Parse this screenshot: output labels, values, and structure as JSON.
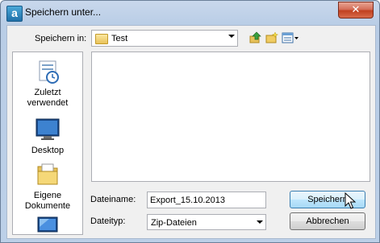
{
  "window": {
    "title": "Speichern unter...",
    "app_icon_letter": "a",
    "close_glyph": "✕"
  },
  "toolbar": {
    "save_in_label": "Speichern in:",
    "folder_value": "Test",
    "icons": [
      "folder-up-icon",
      "new-folder-icon",
      "view-menu-icon"
    ]
  },
  "places": [
    {
      "name": "recent",
      "label_line1": "Zuletzt",
      "label_line2": "verwendet",
      "icon": "recent-icon"
    },
    {
      "name": "desktop",
      "label_line1": "Desktop",
      "label_line2": "",
      "icon": "desktop-icon"
    },
    {
      "name": "documents",
      "label_line1": "Eigene",
      "label_line2": "Dokumente",
      "icon": "documents-icon"
    },
    {
      "name": "computer",
      "label_line1": "",
      "label_line2": "",
      "icon": "computer-icon"
    }
  ],
  "form": {
    "filename_label": "Dateiname:",
    "filename_value": "Export_15.10.2013",
    "filetype_label": "Dateityp:",
    "filetype_value": "Zip-Dateien"
  },
  "buttons": {
    "save": "Speichern",
    "cancel": "Abbrechen"
  }
}
